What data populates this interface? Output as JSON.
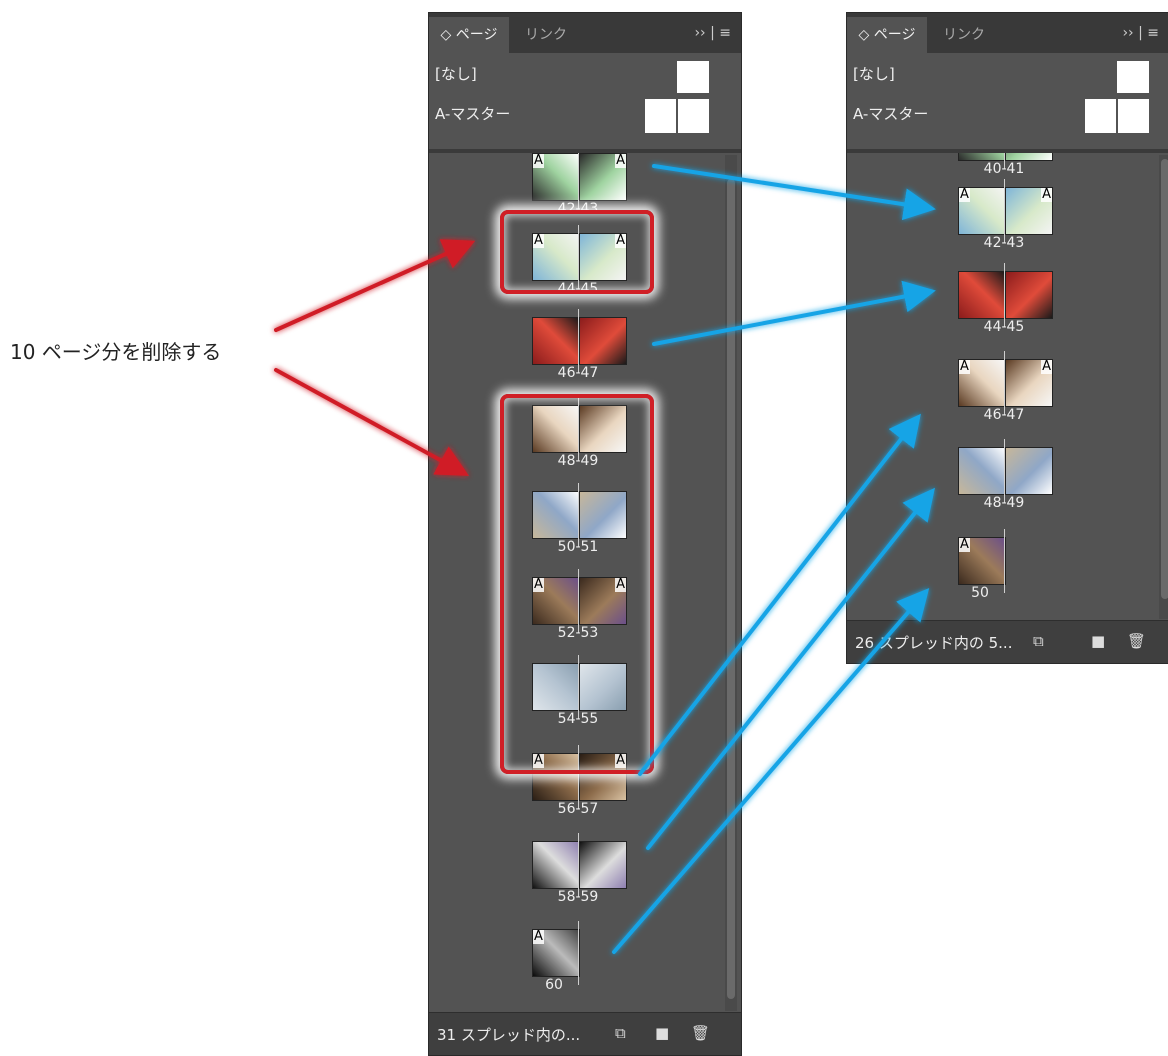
{
  "caption": "10 ページ分を削除する",
  "colors": {
    "panel_bg": "#535353",
    "highlight_red": "#d01f26",
    "arrow_blue": "#17a4e6",
    "arrow_red": "#d01f26"
  },
  "panel_left": {
    "tab_pages": "◇ ページ",
    "tab_links": "リンク",
    "tab_tools": "›› | ≡",
    "master_none": "[なし]",
    "master_a": "A-マスター",
    "spreads": [
      {
        "label": "42-43",
        "a_left": "A",
        "a_right": "A"
      },
      {
        "label": "44-45",
        "a_left": "A",
        "a_right": "A"
      },
      {
        "label": "46-47",
        "a_left": "",
        "a_right": ""
      },
      {
        "label": "48-49",
        "a_left": "",
        "a_right": ""
      },
      {
        "label": "50-51",
        "a_left": "",
        "a_right": ""
      },
      {
        "label": "52-53",
        "a_left": "A",
        "a_right": "A"
      },
      {
        "label": "54-55",
        "a_left": "",
        "a_right": ""
      },
      {
        "label": "56-57",
        "a_left": "A",
        "a_right": "A"
      },
      {
        "label": "58-59",
        "a_left": "",
        "a_right": ""
      },
      {
        "label": "60",
        "a_left": "A",
        "a_right": ""
      }
    ],
    "footer_text": "31 スプレッド内の...",
    "footer_icons": [
      "master-page-icon",
      "new-page-icon",
      "trash-icon"
    ]
  },
  "panel_right": {
    "tab_pages": "◇ ページ",
    "tab_links": "リンク",
    "tab_tools": "›› | ≡",
    "master_none": "[なし]",
    "master_a": "A-マスター",
    "spreads": [
      {
        "label": "40-41",
        "a_left": "",
        "a_right": ""
      },
      {
        "label": "42-43",
        "a_left": "A",
        "a_right": "A"
      },
      {
        "label": "44-45",
        "a_left": "",
        "a_right": ""
      },
      {
        "label": "46-47",
        "a_left": "A",
        "a_right": "A"
      },
      {
        "label": "48-49",
        "a_left": "",
        "a_right": ""
      },
      {
        "label": "50",
        "a_left": "A",
        "a_right": ""
      }
    ],
    "footer_text": "26 スプレッド内の 5...",
    "footer_icons": [
      "master-page-icon",
      "new-page-icon",
      "trash-icon"
    ]
  },
  "icons": {
    "master_page": "⧉",
    "new_page": "■",
    "trash": "🗑"
  }
}
